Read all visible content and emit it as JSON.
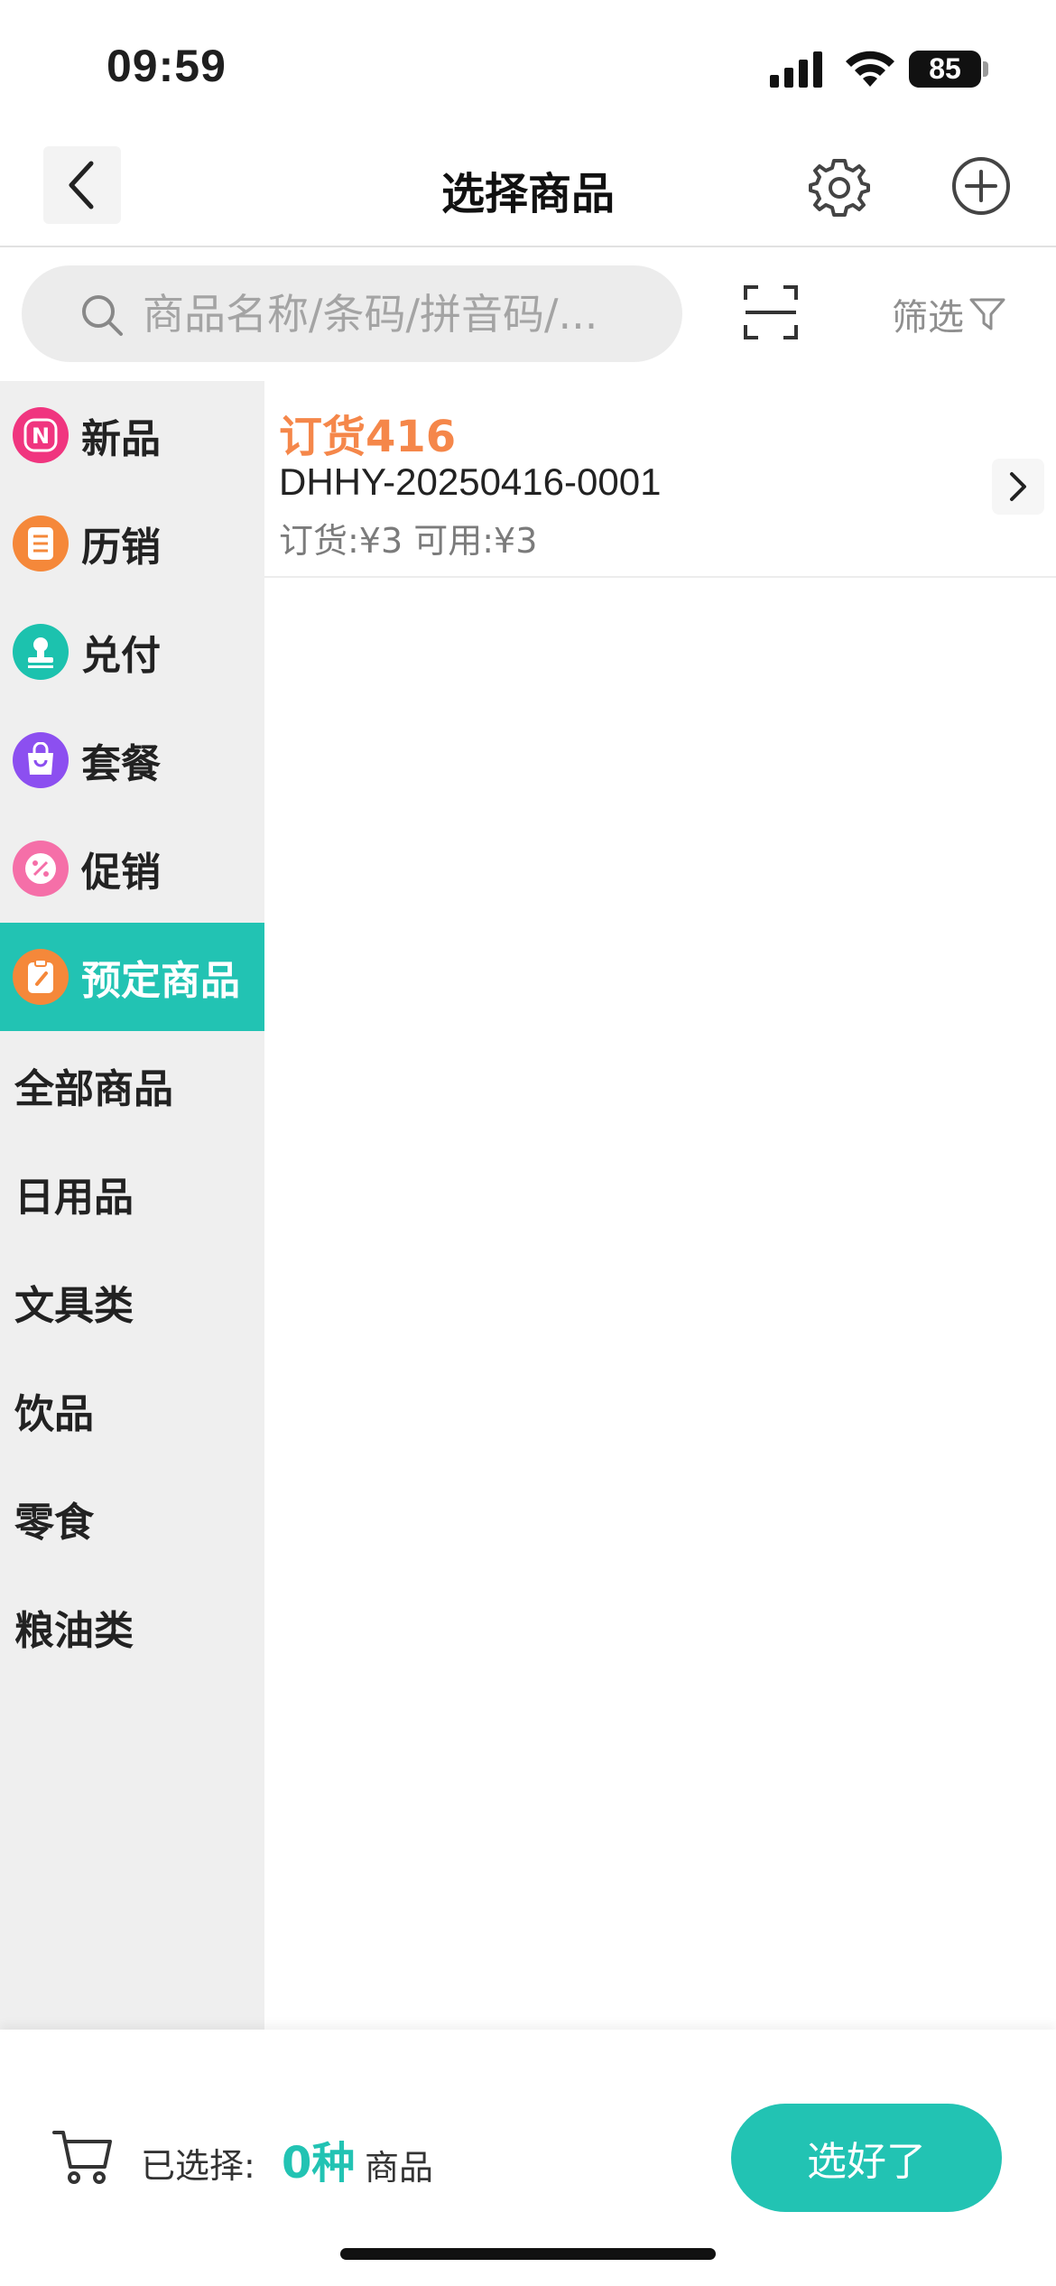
{
  "status_bar": {
    "time": "09:59",
    "battery": "85",
    "icons": [
      "signal-icon",
      "wifi-icon",
      "battery-icon"
    ]
  },
  "nav": {
    "title": "选择商品",
    "icons": [
      "back-arrow-icon",
      "gear-icon",
      "plus-circle-icon"
    ]
  },
  "search": {
    "placeholder": "商品名称/条码/拼音码/...",
    "value": "",
    "filter_label": "筛选",
    "icons": [
      "search-icon",
      "scan-icon",
      "filter-icon"
    ]
  },
  "sidebar": {
    "items": [
      {
        "label": "新品",
        "icon": "new-badge-icon",
        "color": "#f0357f"
      },
      {
        "label": "历销",
        "icon": "list-icon",
        "color": "#f5883a"
      },
      {
        "label": "兑付",
        "icon": "stamp-icon",
        "color": "#1cc2ae"
      },
      {
        "label": "套餐",
        "icon": "bag-icon",
        "color": "#8c4ff0"
      },
      {
        "label": "促销",
        "icon": "discount-icon",
        "color": "#f56fa8"
      },
      {
        "label": "预定商品",
        "icon": "clipboard-icon",
        "color": "#f5883a"
      },
      {
        "label": "全部商品"
      },
      {
        "label": "日用品"
      },
      {
        "label": "文具类"
      },
      {
        "label": "饮品"
      },
      {
        "label": "零食"
      },
      {
        "label": "粮油类"
      }
    ],
    "active": "预定商品",
    "active_color": "#22c3b3"
  },
  "products": [
    {
      "name": "订货416",
      "code": "DHHY-20250416-0001",
      "price_line": "订货:¥3  可用:¥3"
    }
  ],
  "bottom": {
    "selected_label": "已选择:",
    "selected_count": "0种",
    "selected_unit": "商品",
    "confirm_label": "选好了",
    "accent": "#22c3b3",
    "icon": "cart-icon"
  }
}
